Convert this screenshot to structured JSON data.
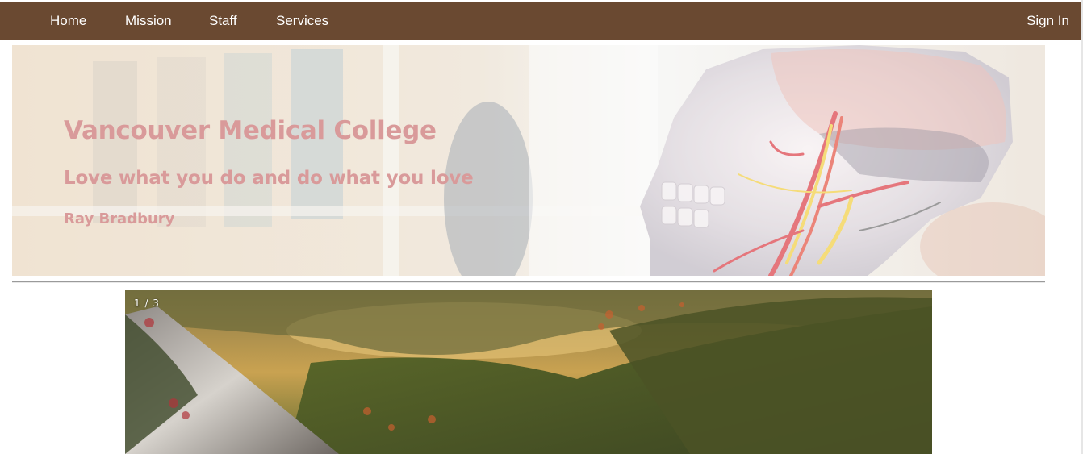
{
  "nav": {
    "items": [
      {
        "label": "Home"
      },
      {
        "label": "Mission"
      },
      {
        "label": "Staff"
      },
      {
        "label": "Services"
      }
    ],
    "sign_in": "Sign In"
  },
  "hero": {
    "title": "Vancouver Medical College",
    "tagline": "Love what you do and do what you love",
    "author": "Ray Bradbury",
    "image_subject": "anatomical-skull-model"
  },
  "slideshow": {
    "counter": "1 / 3",
    "image_subject": "forest-mountain-landscape"
  },
  "colors": {
    "nav_background": "#6a4931",
    "nav_text": "#ffffff",
    "hero_text": "#d99a9a"
  }
}
